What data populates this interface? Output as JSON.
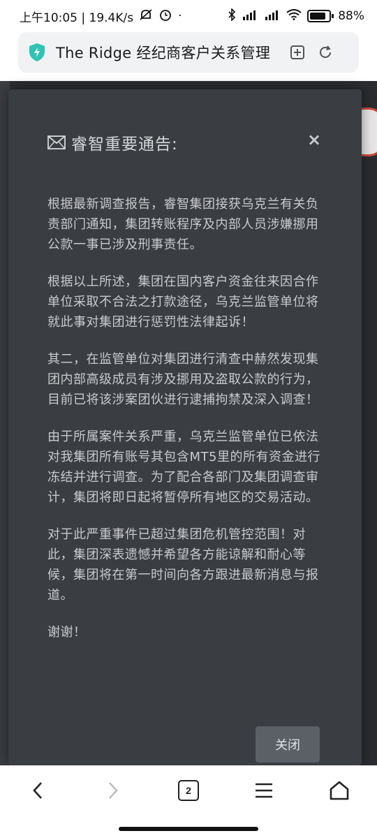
{
  "status_bar": {
    "time_speed": "上午10:05 | 19.4K/s",
    "dot": "·",
    "battery_level": "88%"
  },
  "browser": {
    "page_title": "The Ridge 经纪商客户关系管理",
    "tab_count": "2"
  },
  "modal": {
    "title": "睿智重要通告:",
    "close_symbol": "×",
    "paragraphs": [
      "根据最新调查报告，睿智集团接获乌克兰有关负责部门通知，集团转账程序及内部人员涉嫌挪用公款一事已涉及刑事责任。",
      "根据以上所述，集团在国内客户资金往来因合作单位采取不合法之打款途径，乌克兰监管单位将就此事对集团进行惩罚性法律起诉！",
      "其二，在监管单位对集团进行清查中赫然发现集团内部高级成员有涉及挪用及盗取公款的行为，目前已将该涉案团伙进行逮捕拘禁及深入调查！",
      "由于所属案件关系严重，乌克兰监管单位已依法对我集团所有账号其包含MT5里的所有资金进行冻结并进行调查。为了配合各部门及集团调查审计，集团将即日起将暂停所有地区的交易活动。",
      "对于此严重事件已超过集团危机管控范围！对此，集团深表遗憾并希望各方能谅解和耐心等候，集团将在第一时间向各方跟进最新消息与报道。",
      "谢谢！"
    ],
    "close_button_label": "关闭"
  },
  "colors": {
    "modal_bg": "#3a3d41",
    "overlay_bg": "#2b2d30",
    "shield_accent": "#2fc3b5",
    "button_bg": "#5b5f66"
  }
}
